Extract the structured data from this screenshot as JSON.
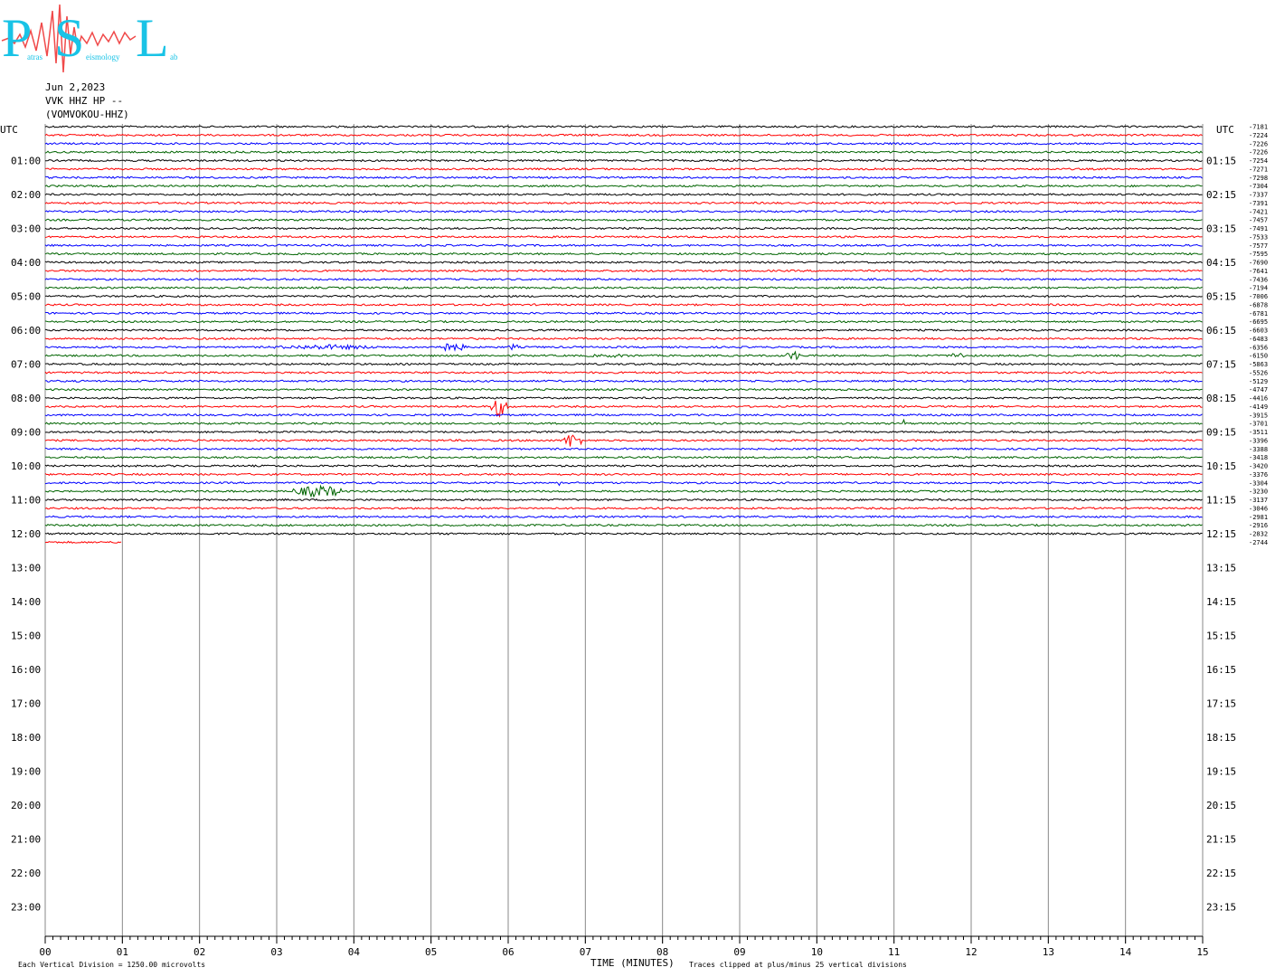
{
  "header": {
    "date": "Jun 2,2023",
    "station": "VVK HHZ HP --",
    "station_name": "(VOMVOKOU-HHZ)"
  },
  "logo": {
    "big_letters": [
      "P",
      "S",
      "L"
    ],
    "small_words": [
      "atras",
      "eismology",
      "ab"
    ],
    "wave_color": "#f04a4a",
    "letter_color": "#19c3e6"
  },
  "chart_data": {
    "type": "line",
    "title": "",
    "xlabel": "TIME (MINUTES)",
    "x_ticks": [
      "00",
      "01",
      "02",
      "03",
      "04",
      "05",
      "06",
      "07",
      "08",
      "09",
      "10",
      "11",
      "12",
      "13",
      "14",
      "15"
    ],
    "xlim": [
      0,
      15
    ],
    "left_axis_label": "UTC",
    "right_axis_label": "UTC",
    "left_hour_labels": [
      "01:00",
      "02:00",
      "03:00",
      "04:00",
      "05:00",
      "06:00",
      "07:00",
      "08:00",
      "09:00",
      "10:00",
      "11:00",
      "12:00",
      "13:00",
      "14:00",
      "15:00",
      "16:00",
      "17:00",
      "18:00",
      "19:00",
      "20:00",
      "21:00",
      "22:00",
      "23:00"
    ],
    "right_hour_labels": [
      "01:15",
      "02:15",
      "03:15",
      "04:15",
      "05:15",
      "06:15",
      "07:15",
      "08:15",
      "09:15",
      "10:15",
      "11:15",
      "12:15",
      "13:15",
      "14:15",
      "15:15",
      "16:15",
      "17:15",
      "18:15",
      "19:15",
      "20:15",
      "21:15",
      "22:15",
      "23:15"
    ],
    "trace_colors": [
      "#000000",
      "#ff0000",
      "#0000ff",
      "#006400"
    ],
    "trace_count": 50,
    "last_trace_end_minute": 1.0,
    "trace_means": [
      "-7181",
      "-7224",
      "-7226",
      "-7226",
      "-7254",
      "-7271",
      "-7298",
      "-7304",
      "-7337",
      "-7391",
      "-7421",
      "-7457",
      "-7491",
      "-7533",
      "-7577",
      "-7595",
      "-7690",
      "-7641",
      "-7436",
      "-7194",
      "-7006",
      "-6878",
      "-6781",
      "-6695",
      "-6603",
      "-6483",
      "-6356",
      "-6150",
      "-5863",
      "-5526",
      "-5129",
      "-4747",
      "-4416",
      "-4149",
      "-3915",
      "-3701",
      "-3511",
      "-3396",
      "-3388",
      "-3418",
      "-3420",
      "-3376",
      "-3304",
      "-3230",
      "-3137",
      "-3046",
      "-2981",
      "-2916",
      "-2832",
      "-2744"
    ],
    "events": [
      {
        "trace": 26,
        "start_min": 2.9,
        "end_min": 4.4,
        "amplitude": 3
      },
      {
        "trace": 26,
        "start_min": 5.0,
        "end_min": 5.5,
        "amplitude": 5
      },
      {
        "trace": 26,
        "start_min": 6.0,
        "end_min": 6.15,
        "amplitude": 4
      },
      {
        "trace": 27,
        "start_min": 6.9,
        "end_min": 7.8,
        "amplitude": 2
      },
      {
        "trace": 27,
        "start_min": 9.6,
        "end_min": 9.8,
        "amplitude": 6
      },
      {
        "trace": 27,
        "start_min": 11.7,
        "end_min": 11.95,
        "amplitude": 4
      },
      {
        "trace": 33,
        "start_min": 5.75,
        "end_min": 6.0,
        "amplitude": 12
      },
      {
        "trace": 35,
        "start_min": 11.1,
        "end_min": 11.15,
        "amplitude": 5
      },
      {
        "trace": 37,
        "start_min": 6.7,
        "end_min": 6.95,
        "amplitude": 9
      },
      {
        "trace": 42,
        "start_min": 6.65,
        "end_min": 6.7,
        "amplitude": 4
      },
      {
        "trace": 43,
        "start_min": 3.2,
        "end_min": 3.9,
        "amplitude": 7
      }
    ]
  },
  "footer": {
    "division_note": "Each Vertical Division = 1250.00 microvolts",
    "clip_note": "Traces clipped at plus/minus 25 vertical divisions"
  }
}
